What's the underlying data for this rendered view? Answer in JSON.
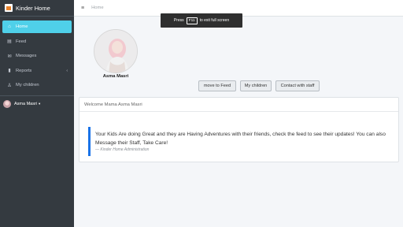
{
  "brand": {
    "title": "Kinder Home"
  },
  "sidebar": {
    "items": [
      {
        "label": "Home",
        "icon": "home-icon",
        "glyph": "⌂",
        "active": true
      },
      {
        "label": "Feed",
        "icon": "feed-icon",
        "glyph": "▤"
      },
      {
        "label": "Messages",
        "icon": "envelope-icon",
        "glyph": "✉"
      },
      {
        "label": "Reports",
        "icon": "file-icon",
        "glyph": "▮",
        "caret": "‹"
      },
      {
        "label": "My children",
        "icon": "child-icon",
        "glyph": "♙"
      }
    ],
    "user": {
      "name": "Asma Masri",
      "caret": "▾"
    }
  },
  "topbar": {
    "menu_glyph": "≡",
    "breadcrumb": "Home"
  },
  "fullscreen_notice": {
    "prefix": "Press",
    "key": "F11",
    "suffix": "to exit full screen"
  },
  "profile": {
    "name": "Asma Masri"
  },
  "actions": {
    "move_to_feed": "move to Feed",
    "my_children": "My children",
    "contact_staff": "Contact with staff"
  },
  "welcome_card": {
    "header": "Welcome Mama Asma Masri",
    "message": "Your Kids Are doing Great and they are Having Adventures with their friends, check the feed to see their updates! You can also Message their Staff, Take Care!",
    "signature": "— Kinder Home Administration"
  },
  "colors": {
    "sidebar": "#343a40",
    "active": "#4fd0e9",
    "quote_border": "#1a73e8"
  }
}
